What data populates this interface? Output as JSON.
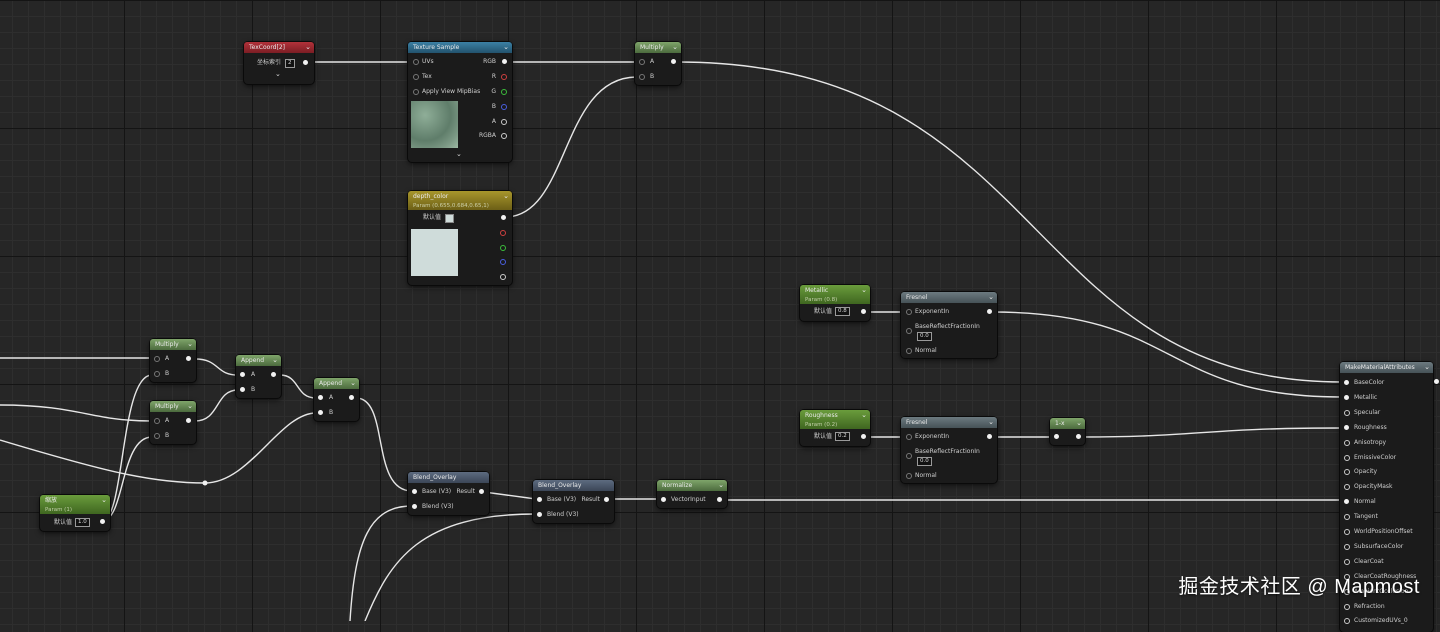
{
  "nodes": {
    "texcoord": {
      "title": "TexCoord[2]",
      "field_label": "坐标索引",
      "field_value": "2"
    },
    "texture_sample": {
      "title": "Texture Sample",
      "inputs": [
        "UVs",
        "Tex",
        "Apply View MipBias"
      ],
      "outputs": [
        "RGB",
        "R",
        "G",
        "B",
        "A",
        "RGBA"
      ]
    },
    "multiply_top": {
      "title": "Multiply",
      "inputs": [
        "A",
        "B"
      ]
    },
    "depth_color": {
      "title": "depth_color",
      "subtitle": "Param (0.655,0.684,0.65,1)",
      "default_label": "默认值"
    },
    "metallic_param": {
      "title": "Metallic",
      "subtitle": "Param (0.8)",
      "default_label": "默认值",
      "default_value": "0.8"
    },
    "fresnel_1": {
      "title": "Fresnel",
      "pins": [
        "ExponentIn",
        "BaseReflectFractionIn",
        "Normal"
      ],
      "value": "0.0"
    },
    "roughness_param": {
      "title": "Roughness",
      "subtitle": "Param (0.2)",
      "default_label": "默认值",
      "default_value": "0.2"
    },
    "fresnel_2": {
      "title": "Fresnel",
      "pins": [
        "ExponentIn",
        "BaseReflectFractionIn",
        "Normal"
      ],
      "value": "0.0"
    },
    "one_minus": {
      "title": "1-x"
    },
    "multiply_a": {
      "title": "Multiply",
      "inputs": [
        "A",
        "B"
      ]
    },
    "multiply_b": {
      "title": "Multiply",
      "inputs": [
        "A",
        "B"
      ]
    },
    "append_1": {
      "title": "Append",
      "inputs": [
        "A",
        "B"
      ]
    },
    "append_2": {
      "title": "Append",
      "inputs": [
        "A",
        "B"
      ]
    },
    "scale_param": {
      "title": "缩放",
      "subtitle": "Param (1)",
      "default_label": "默认值",
      "default_value": "1.0"
    },
    "blend_overlay_1": {
      "title": "Blend_Overlay",
      "inputs": [
        "Base (V3)",
        "Blend (V3)"
      ],
      "output": "Result"
    },
    "blend_overlay_2": {
      "title": "Blend_Overlay",
      "inputs": [
        "Base (V3)",
        "Blend (V3)"
      ],
      "output": "Result"
    },
    "normalize": {
      "title": "Normalize",
      "input": "VectorInput"
    },
    "make_material": {
      "title": "MakeMaterialAttributes",
      "inputs": [
        "BaseColor",
        "Metallic",
        "Specular",
        "Roughness",
        "Anisotropy",
        "EmissiveColor",
        "Opacity",
        "OpacityMask",
        "Normal",
        "Tangent",
        "WorldPositionOffset",
        "SubsurfaceColor",
        "ClearCoat",
        "ClearCoatRoughness",
        "AmbientOcclusion",
        "Refraction",
        "CustomizedUVs_0"
      ]
    }
  },
  "watermark": "掘金技术社区 @ Mapmost",
  "colors": {
    "wire": "#e8e8e8",
    "background": "#262626"
  }
}
